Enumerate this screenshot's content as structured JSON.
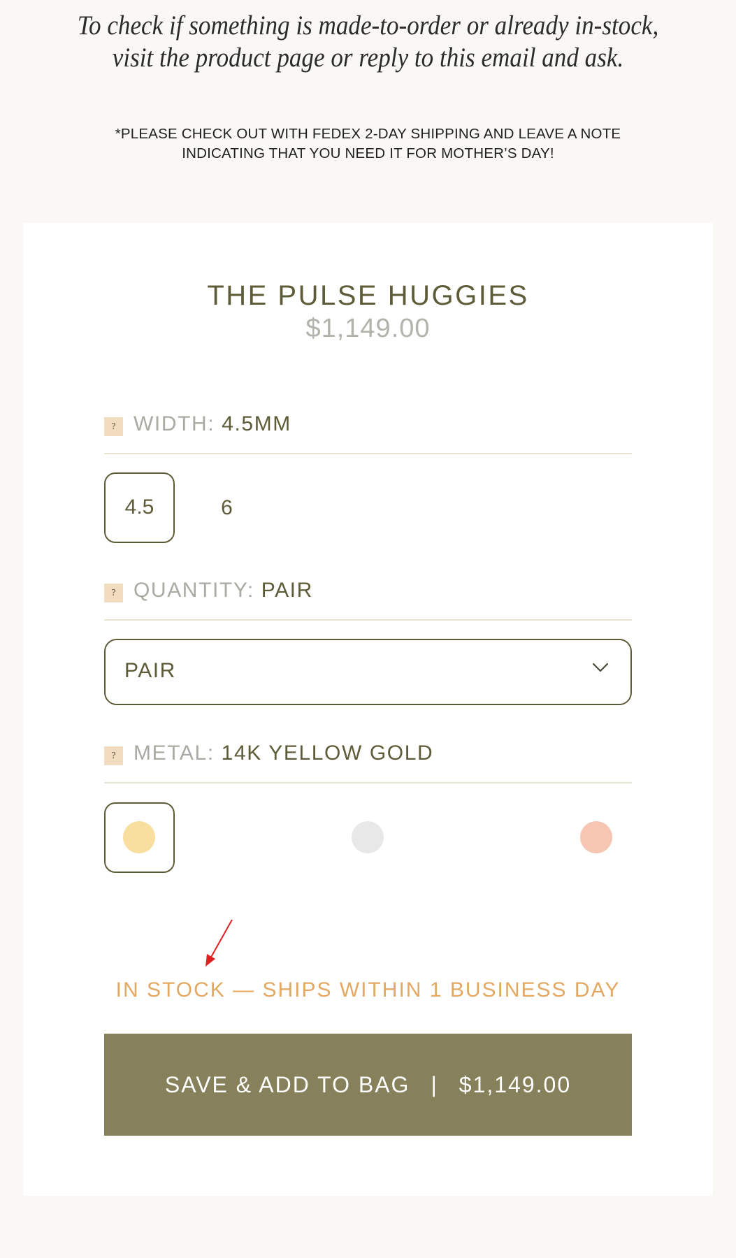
{
  "intro": {
    "line1": "To check if something is made-to-order or already in-stock,",
    "line2": "visit the product page or reply to this email and ask."
  },
  "note": {
    "line1": "*PLEASE CHECK OUT WITH FEDEX 2-DAY SHIPPING AND LEAVE A NOTE",
    "line2": "INDICATING THAT YOU NEED IT FOR MOTHER’S DAY!"
  },
  "product": {
    "title": "THE PULSE HUGGIES",
    "price": "$1,149.00"
  },
  "width_option": {
    "help": "?",
    "label": "WIDTH:",
    "value": "4.5MM",
    "choices": [
      {
        "label": "4.5",
        "selected": true
      },
      {
        "label": "6",
        "selected": false
      }
    ]
  },
  "quantity_option": {
    "help": "?",
    "label": "QUANTITY:",
    "value": "PAIR",
    "selected": "PAIR",
    "icon": "chevron-down-icon"
  },
  "metal_option": {
    "help": "?",
    "label": "METAL:",
    "value": "14K YELLOW GOLD",
    "swatches": [
      {
        "color": "#f9df9f",
        "selected": true
      },
      {
        "color": "#e8e8e8",
        "selected": false
      },
      {
        "color": "#f6c6b2",
        "selected": false
      }
    ]
  },
  "annotation": {
    "icon": "red-arrow-icon",
    "color": "#e02020"
  },
  "stock_status": "IN STOCK — SHIPS WITHIN 1 BUSINESS DAY",
  "cta": {
    "label": "SAVE & ADD TO BAG",
    "separator": "|",
    "price": "$1,149.00"
  },
  "colors": {
    "background": "#f9f8f4",
    "olive": "#5e5c38",
    "button": "#86815a",
    "stock": "#e3a962",
    "rule": "#e7e3cc"
  }
}
